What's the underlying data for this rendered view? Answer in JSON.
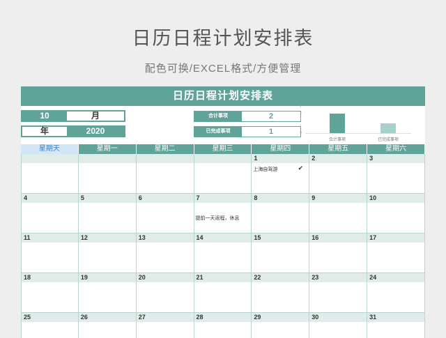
{
  "page": {
    "title": "日历日程计划安排表",
    "subtitle": "配色可换/EXCEL格式/方便管理"
  },
  "sheet": {
    "header": "日历日程计划安排表",
    "month_value": "10",
    "month_label": "月",
    "year_label": "年",
    "year_value": "2020",
    "stats": [
      {
        "label": "合计事项",
        "value": "2"
      },
      {
        "label": "已完成事项",
        "value": "1"
      }
    ],
    "colors": {
      "accent": "#5fa399",
      "accent_light": "#a8d0cb",
      "row": "#dfecea",
      "sunday": "#d3e6f5"
    }
  },
  "chart_data": {
    "type": "bar",
    "categories": [
      "合计事项",
      "已完成事项"
    ],
    "values": [
      2,
      1
    ],
    "ylim": [
      0,
      2
    ],
    "yticks": [
      "2",
      "2",
      "1",
      "1",
      "0"
    ]
  },
  "calendar": {
    "weekdays": [
      "星期天",
      "星期一",
      "星期二",
      "星期三",
      "星期四",
      "星期五",
      "星期六"
    ],
    "weeks": [
      [
        {
          "n": ""
        },
        {
          "n": ""
        },
        {
          "n": ""
        },
        {
          "n": ""
        },
        {
          "n": "1",
          "note": "上海自驾游",
          "check": "✔"
        },
        {
          "n": "2"
        },
        {
          "n": "3"
        }
      ],
      [
        {
          "n": "4"
        },
        {
          "n": "5"
        },
        {
          "n": "6"
        },
        {
          "n": "7",
          "note": "提前一天返程，休息"
        },
        {
          "n": "8"
        },
        {
          "n": "9"
        },
        {
          "n": "10"
        }
      ],
      [
        {
          "n": "11"
        },
        {
          "n": "12"
        },
        {
          "n": "13"
        },
        {
          "n": "14"
        },
        {
          "n": "15"
        },
        {
          "n": "16"
        },
        {
          "n": "17"
        }
      ],
      [
        {
          "n": "18"
        },
        {
          "n": "19"
        },
        {
          "n": "20"
        },
        {
          "n": "21"
        },
        {
          "n": "22"
        },
        {
          "n": "23"
        },
        {
          "n": "24"
        }
      ],
      [
        {
          "n": "25"
        },
        {
          "n": "26"
        },
        {
          "n": "27"
        },
        {
          "n": "28"
        },
        {
          "n": "29"
        },
        {
          "n": "30"
        },
        {
          "n": "31"
        }
      ]
    ]
  }
}
